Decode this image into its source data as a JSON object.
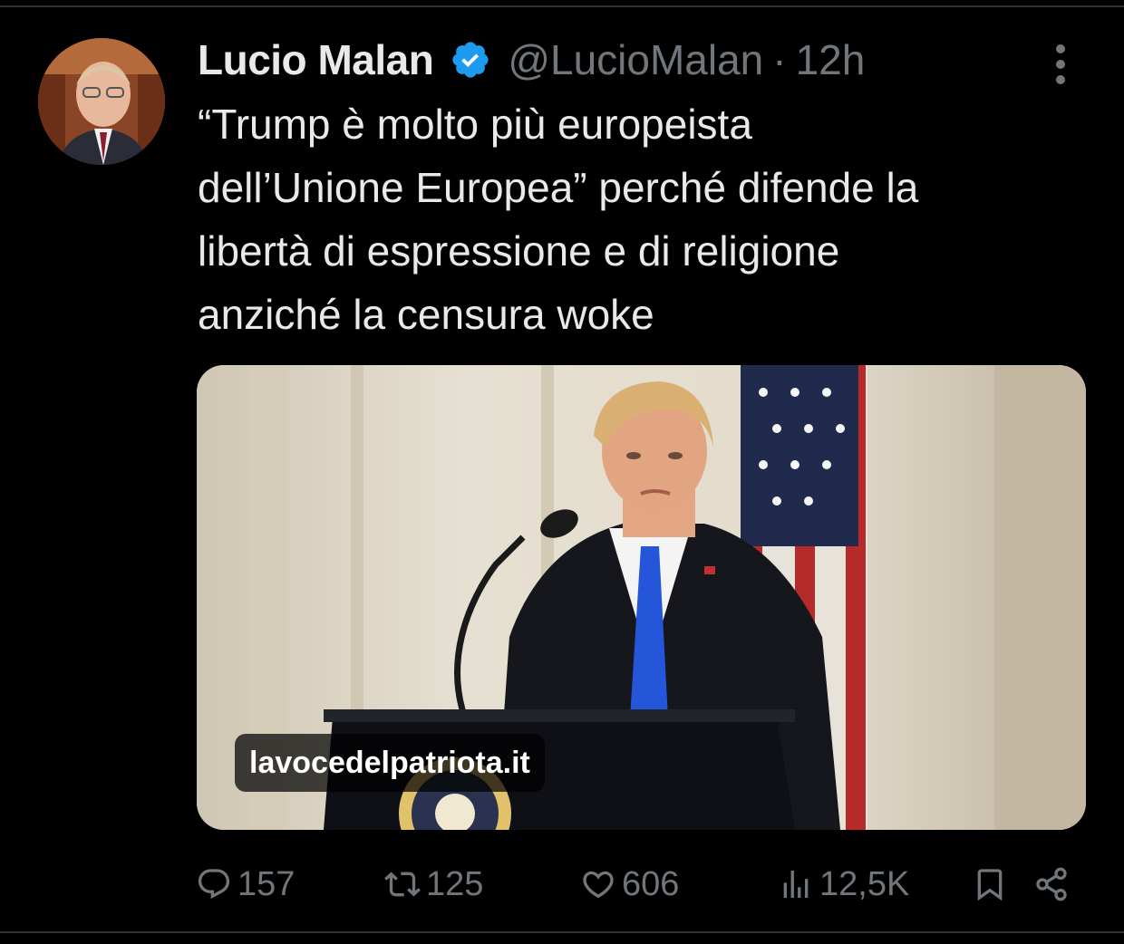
{
  "tweet": {
    "author_name": "Lucio Malan",
    "handle": "@LucioMalan",
    "separator": "·",
    "time": "12h",
    "text": "“Trump è molto più europeista\ndell’Unione Europea” perché difende la\nlibertà di espressione e di religione\nanziché la censura woke",
    "media": {
      "source_label": "lavocedelpatriota.it"
    },
    "stats": {
      "replies": "157",
      "retweets": "125",
      "likes": "606",
      "views": "12,5K"
    }
  },
  "icons": {
    "verified": "verified-badge-icon",
    "more": "more-vertical-icon",
    "reply": "reply-icon",
    "retweet": "retweet-icon",
    "like": "heart-icon",
    "views": "views-chart-icon",
    "bookmark": "bookmark-icon",
    "share": "share-icon"
  },
  "colors": {
    "background": "#000000",
    "text": "#e7e9ea",
    "secondary": "#71767b",
    "verified": "#1d9bf0"
  }
}
